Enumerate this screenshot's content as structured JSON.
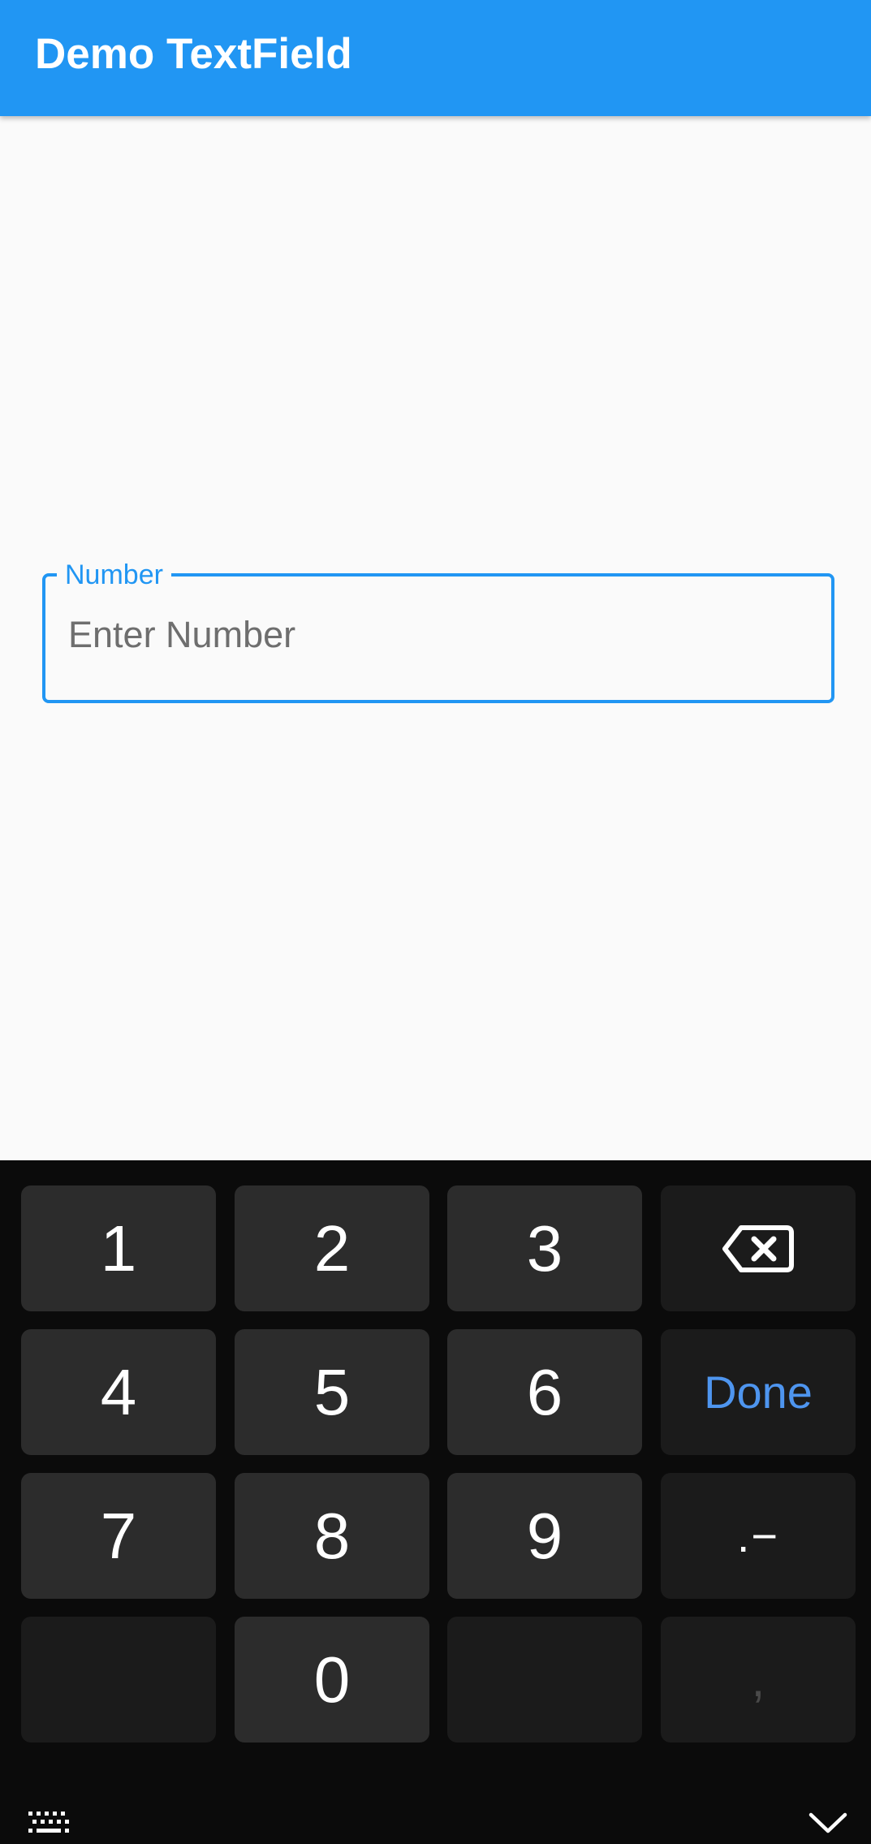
{
  "app_bar": {
    "title": "Demo TextField",
    "color": "#2196f3"
  },
  "text_field": {
    "label": "Number",
    "placeholder": "Enter Number",
    "value": "",
    "accent": "#2196f3"
  },
  "keyboard": {
    "keys": {
      "k1": "1",
      "k2": "2",
      "k3": "3",
      "k4": "4",
      "k5": "5",
      "k6": "6",
      "k7": "7",
      "k8": "8",
      "k9": "9",
      "k0": "0",
      "done": "Done",
      "punct": ".−",
      "comma": ","
    },
    "icons": {
      "backspace": "backspace-icon",
      "switch_keyboard": "keyboard-icon",
      "hide_keyboard": "chevron-down-icon"
    },
    "done_color": "#4e95ef"
  }
}
